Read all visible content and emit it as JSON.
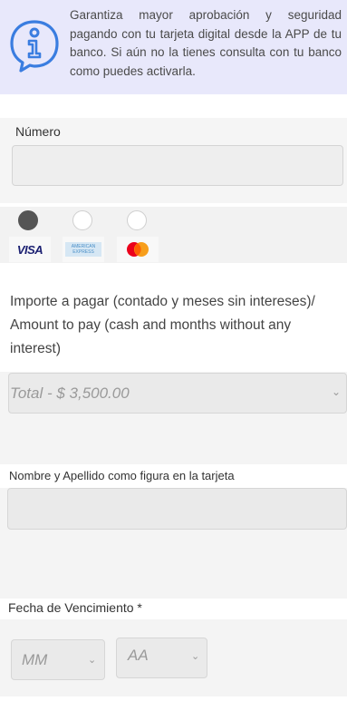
{
  "info": {
    "text": "Garantiza mayor aprobación y seguridad pagando con tu tarjeta digital desde la APP de tu banco. Si aún no la tienes consulta con tu banco como puedes activarla.",
    "icon": "info-icon"
  },
  "numero": {
    "label": "Número",
    "value": ""
  },
  "cards": [
    {
      "name": "VISA",
      "selected": true
    },
    {
      "name": "AMERICAN EXPRESS",
      "selected": false
    },
    {
      "name": "Mastercard",
      "selected": false
    }
  ],
  "importe": {
    "label": "Importe a pagar (contado y meses sin intereses)/ Amount to pay (cash and months without any interest)",
    "selected": "Total - $ 3,500.00"
  },
  "nombre": {
    "label": "Nombre y Apellido como figura en la tarjeta",
    "value": ""
  },
  "fecha": {
    "label": "Fecha de Vencimiento *",
    "month_placeholder": "MM",
    "year_placeholder": "AA"
  },
  "colors": {
    "banner_bg": "#e8e8fb",
    "icon_blue": "#3a7de0",
    "radio_selected": "#555555"
  }
}
